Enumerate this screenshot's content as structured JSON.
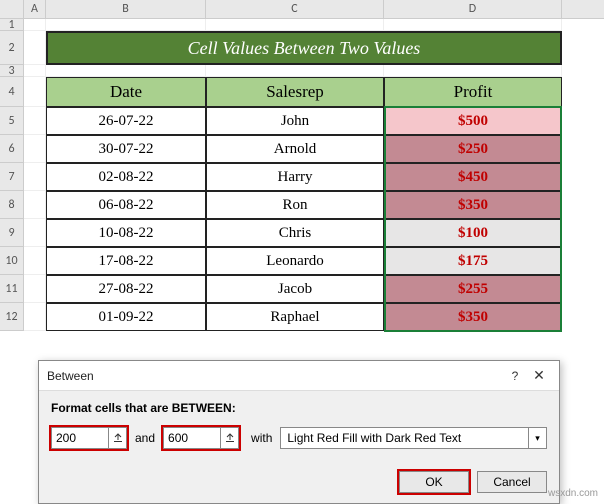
{
  "columns": {
    "A": "A",
    "B": "B",
    "C": "C",
    "D": "D"
  },
  "rowNums": [
    "1",
    "2",
    "3",
    "4",
    "5",
    "6",
    "7",
    "8",
    "9",
    "10",
    "11",
    "12"
  ],
  "title": "Cell Values Between Two Values",
  "headers": {
    "date": "Date",
    "salesrep": "Salesrep",
    "profit": "Profit"
  },
  "rows": [
    {
      "date": "26-07-22",
      "name": "John",
      "profit": "$500",
      "hl": "light"
    },
    {
      "date": "30-07-22",
      "name": "Arnold",
      "profit": "$250",
      "hl": "dark"
    },
    {
      "date": "02-08-22",
      "name": "Harry",
      "profit": "$450",
      "hl": "dark"
    },
    {
      "date": "06-08-22",
      "name": "Ron",
      "profit": "$350",
      "hl": "dark"
    },
    {
      "date": "10-08-22",
      "name": "Chris",
      "profit": "$100",
      "hl": "none"
    },
    {
      "date": "17-08-22",
      "name": "Leonardo",
      "profit": "$175",
      "hl": "none"
    },
    {
      "date": "27-08-22",
      "name": "Jacob",
      "profit": "$255",
      "hl": "dark"
    },
    {
      "date": "01-09-22",
      "name": "Raphael",
      "profit": "$350",
      "hl": "dark"
    }
  ],
  "dialog": {
    "title": "Between",
    "help": "?",
    "close": "✕",
    "label": "Format cells that are BETWEEN:",
    "val1": "200",
    "and": "and",
    "val2": "600",
    "with": "with",
    "combo": "Light Red Fill with Dark Red Text",
    "ok": "OK",
    "cancel": "Cancel"
  },
  "watermark": "wsxdn.com"
}
